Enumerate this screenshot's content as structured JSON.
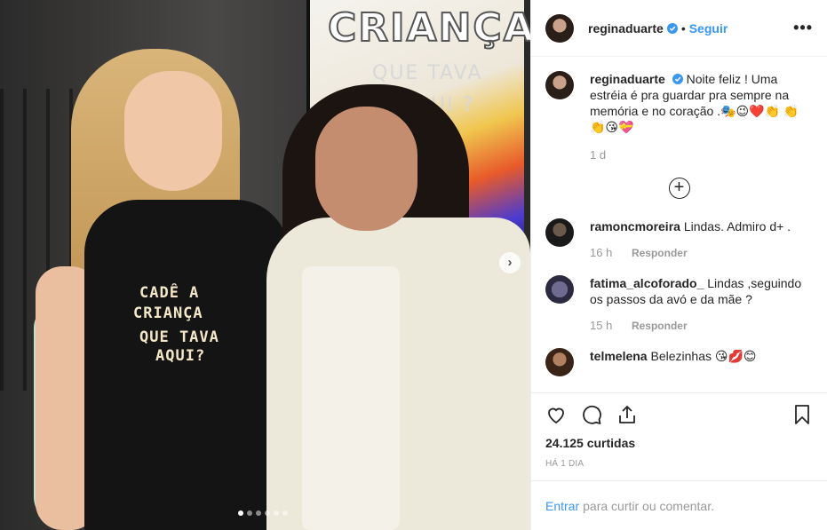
{
  "photo": {
    "sign_line1": "CRIANÇA",
    "sign_line2": "QUE TAVA",
    "sign_line3": "AQUI ?",
    "shirt_line1": "CADÊ A",
    "shirt_line2": "CRIANÇA",
    "shirt_line3": "QUE TAVA",
    "shirt_line4": "AQUI?",
    "carousel_count": 6,
    "carousel_active": 0
  },
  "header": {
    "username": "reginaduarte",
    "separator": "•",
    "follow_label": "Seguir",
    "more_label": "•••"
  },
  "caption": {
    "username": "reginaduarte",
    "text": "Noite feliz ! Uma estréia é pra guardar pra sempre na memória e no coração .🎭😉❤️👏 👏👏😘💝",
    "time": "1 d"
  },
  "comments": [
    {
      "username": "ramoncmoreira",
      "text": "Lindas. Admiro d+ .",
      "time": "16 h",
      "reply_label": "Responder"
    },
    {
      "username": "fatima_alcoforado_",
      "text": "Lindas ,seguindo os passos da avó e da mãe ?",
      "time": "15 h",
      "reply_label": "Responder"
    },
    {
      "username": "telmelena",
      "text": "Belezinhas 😘💋😊"
    }
  ],
  "footer": {
    "likes": "24.125 curtidas",
    "ago": "HÁ 1 DIA",
    "login_label": "Entrar",
    "composer_text": "para curtir ou comentar."
  },
  "colors": {
    "link": "#3897f0",
    "text": "#262626",
    "muted": "#999999"
  }
}
